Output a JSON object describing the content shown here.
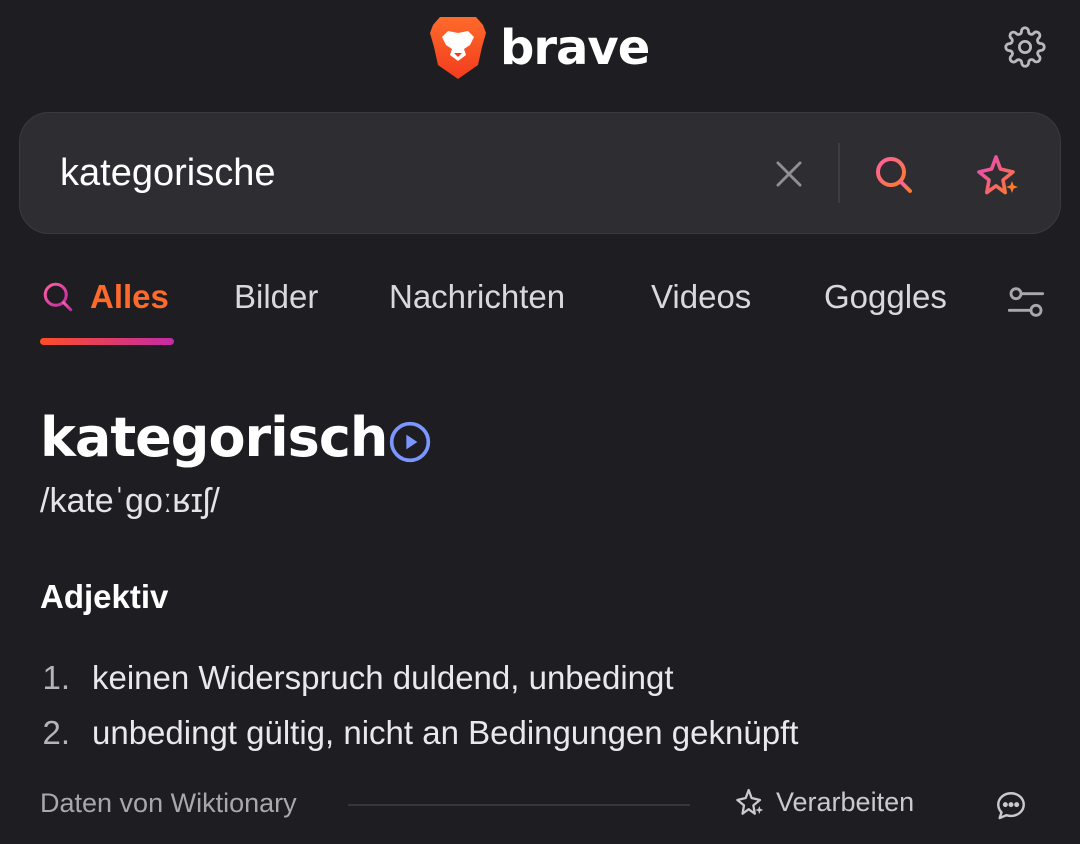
{
  "header": {
    "brand_name": "brave",
    "logo_icon": "brave-lion-logo",
    "settings_icon": "gear-icon"
  },
  "search": {
    "query": "kategorische",
    "clear_icon": "close-icon",
    "search_icon": "search-icon",
    "ai_icon": "sparkle-icon"
  },
  "tabs": {
    "active_icon": "search-icon",
    "items": [
      {
        "label": "Alles",
        "active": true
      },
      {
        "label": "Bilder",
        "active": false
      },
      {
        "label": "Nachrichten",
        "active": false
      },
      {
        "label": "Videos",
        "active": false
      },
      {
        "label": "Goggles",
        "active": false
      }
    ],
    "filter_icon": "sliders-icon"
  },
  "dictionary": {
    "word": "kategorisch",
    "play_icon": "play-circle-icon",
    "phonetic": "/kateˈɡoːʁɪʃ/",
    "part_of_speech": "Adjektiv",
    "definitions": [
      {
        "number": "1.",
        "text": "keinen Widerspruch duldend, unbedingt"
      },
      {
        "number": "2.",
        "text": "unbedingt gültig, nicht an Bedingungen geknüpft"
      }
    ],
    "source": "Daten von Wiktionary",
    "process_label": "Verarbeiten",
    "process_icon": "sparkle-icon",
    "feedback_icon": "chat-bubble-icon"
  },
  "colors": {
    "background": "#1e1e22",
    "search_bar": "#2d2d32",
    "accent_orange": "#ff6a2a",
    "accent_magenta": "#c42ba6",
    "play_blue": "#7d96ff"
  }
}
